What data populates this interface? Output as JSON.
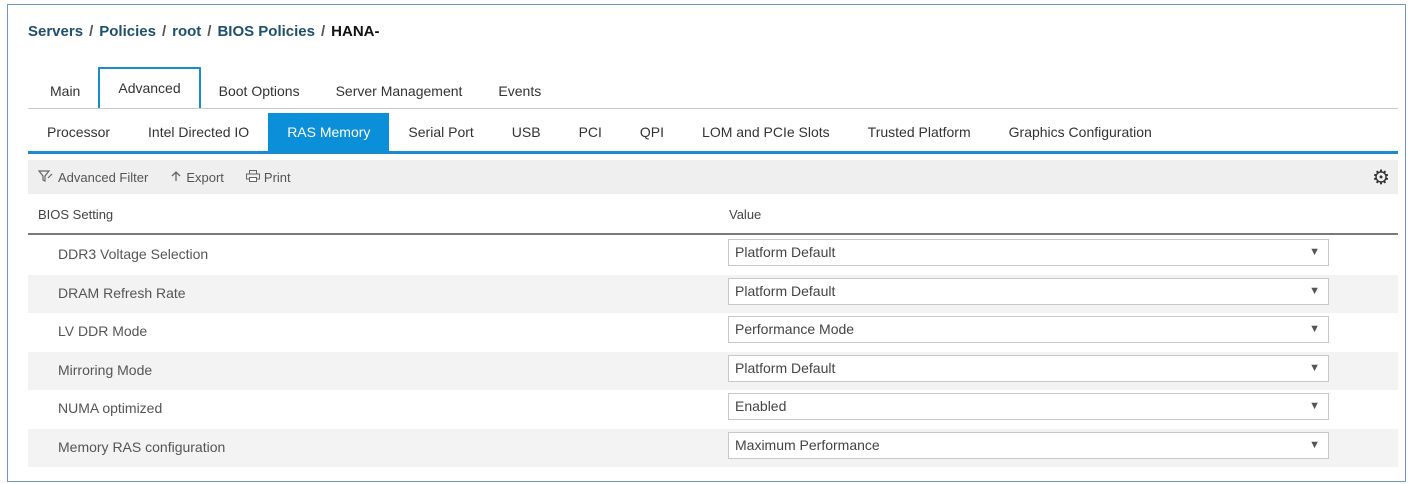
{
  "breadcrumb": {
    "items": [
      "Servers",
      "Policies",
      "root",
      "BIOS Policies"
    ],
    "current": "HANA-",
    "separator": "/"
  },
  "tabs_top": [
    "Main",
    "Advanced",
    "Boot Options",
    "Server Management",
    "Events"
  ],
  "tabs_top_active": "Advanced",
  "tabs_sub": [
    "Processor",
    "Intel Directed IO",
    "RAS Memory",
    "Serial Port",
    "USB",
    "PCI",
    "QPI",
    "LOM and PCIe Slots",
    "Trusted Platform",
    "Graphics Configuration"
  ],
  "tabs_sub_active": "RAS Memory",
  "toolbar": {
    "filter_label": "Advanced Filter",
    "export_label": "Export",
    "print_label": "Print"
  },
  "table": {
    "columns": [
      "BIOS Setting",
      "Value"
    ],
    "rows": [
      {
        "setting": "DDR3 Voltage Selection",
        "value": "Platform Default"
      },
      {
        "setting": "DRAM Refresh Rate",
        "value": "Platform Default"
      },
      {
        "setting": "LV DDR Mode",
        "value": "Performance Mode"
      },
      {
        "setting": "Mirroring Mode",
        "value": "Platform Default"
      },
      {
        "setting": "NUMA optimized",
        "value": "Enabled"
      },
      {
        "setting": "Memory RAS configuration",
        "value": "Maximum Performance"
      }
    ]
  },
  "icons": {
    "filter": "filter-icon",
    "export": "export-arrow-icon",
    "print": "printer-icon",
    "settings": "gear-icon",
    "dropdown": "caret-down-icon"
  },
  "colors": {
    "accent": "#0b8fd8",
    "frame_border": "#6f95c9",
    "toolbar_bg": "#efefef"
  }
}
